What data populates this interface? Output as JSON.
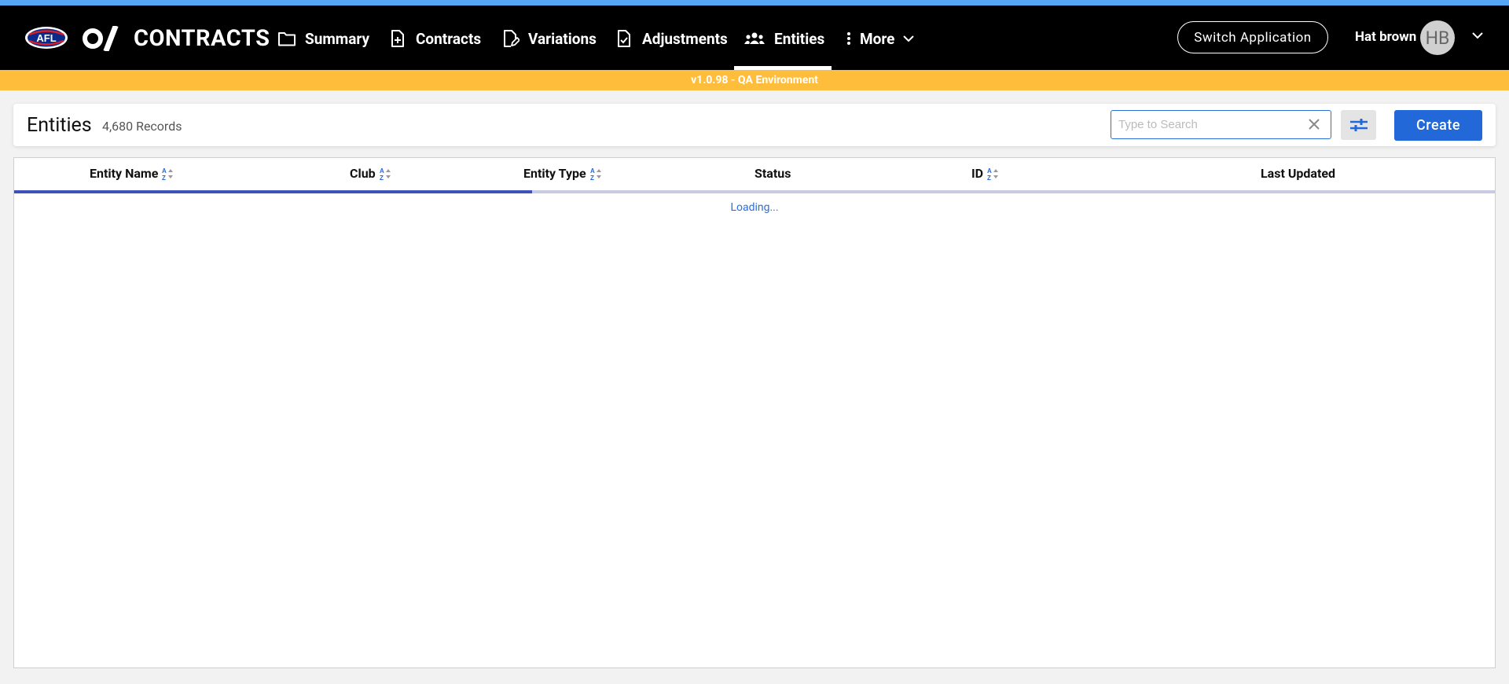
{
  "app": {
    "brand_text": "CONTRACTS",
    "afl_logo_text": "AFL",
    "env_banner": "v1.0.98 - QA Environment"
  },
  "nav": {
    "items": [
      {
        "label": "Summary",
        "icon": "folder-icon"
      },
      {
        "label": "Contracts",
        "icon": "document-add-icon"
      },
      {
        "label": "Variations",
        "icon": "document-edit-icon"
      },
      {
        "label": "Adjustments",
        "icon": "document-check-icon"
      },
      {
        "label": "Entities",
        "icon": "people-icon",
        "active": true
      },
      {
        "label": "More",
        "icon": "more-vertical-icon"
      }
    ]
  },
  "header_right": {
    "switch_label": "Switch Application",
    "user_name": "Hat brown",
    "avatar_initials": "HB"
  },
  "page": {
    "title": "Entities",
    "record_count": "4,680 Records",
    "search_placeholder": "Type to Search",
    "search_value": "",
    "create_label": "Create"
  },
  "table": {
    "columns": [
      {
        "label": "Entity Name",
        "sortable": true
      },
      {
        "label": "Club",
        "sortable": true
      },
      {
        "label": "Entity Type",
        "sortable": true
      },
      {
        "label": "Status",
        "sortable": false
      },
      {
        "label": "ID",
        "sortable": true
      },
      {
        "label": "Last Updated",
        "sortable": false
      }
    ],
    "loading_text": "Loading...",
    "progress": 0.35
  },
  "colors": {
    "accent": "#2268d8",
    "banner": "#ffbd3c",
    "topstrip": "#55a6f5",
    "progress": "#3f51b5"
  }
}
